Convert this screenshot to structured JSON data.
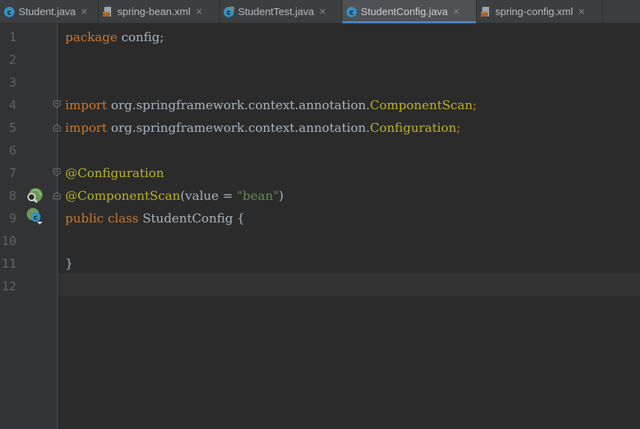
{
  "tabs": [
    {
      "label": "Student.java",
      "icon": "java-class-icon",
      "close": "×",
      "active": false
    },
    {
      "label": "spring-bean.xml",
      "icon": "xml-file-icon",
      "close": "×",
      "active": false
    },
    {
      "label": "StudentTest.java",
      "icon": "java-test-class-icon",
      "close": "×",
      "active": false
    },
    {
      "label": "StudentConfig.java",
      "icon": "java-class-icon",
      "close": "×",
      "active": true
    },
    {
      "label": "spring-config.xml",
      "icon": "xml-file-icon",
      "close": "×",
      "active": false
    }
  ],
  "editor": {
    "line_numbers": [
      "1",
      "2",
      "3",
      "4",
      "5",
      "6",
      "7",
      "8",
      "9",
      "10",
      "11",
      "12"
    ],
    "lines": {
      "l1": {
        "kw": "package",
        "rest": " config;"
      },
      "l4": {
        "kw": "import",
        "pkg": " org.springframework.context.annotation.",
        "cls": "ComponentScan",
        "end": ";"
      },
      "l5": {
        "kw": "import",
        "pkg": " org.springframework.context.annotation.",
        "cls": "Configuration",
        "end": ";"
      },
      "l7": {
        "ann": "@Configuration"
      },
      "l8": {
        "ann": "@ComponentScan",
        "open": "(value = ",
        "str": "\"bean\"",
        "close": ")"
      },
      "l9": {
        "kw": "public class",
        "rest": " StudentConfig {"
      },
      "l11": {
        "rest": "}"
      }
    },
    "gutter_icons": {
      "line8": "spring-bean-search-icon",
      "line9": "spring-config-class-icon"
    },
    "colors": {
      "background": "#2b2b2b",
      "keyword": "#cc7832",
      "annotation": "#bbb529",
      "string": "#6a8759",
      "text": "#a9b7c6",
      "line_number": "#606366",
      "active_tab_underline": "#4a88c7"
    }
  }
}
